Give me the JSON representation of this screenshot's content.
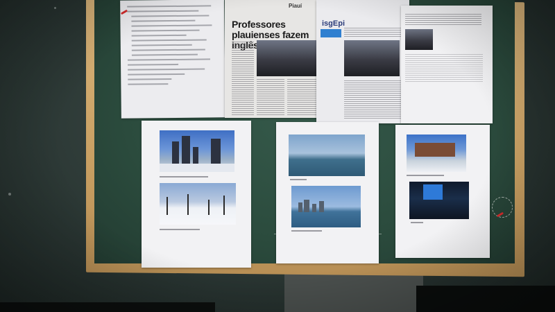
{
  "newspaper": {
    "headline": "Professores plauienses fazem inglês nos EUA",
    "masthead": "Piauí",
    "second_masthead": "isgEpi"
  }
}
